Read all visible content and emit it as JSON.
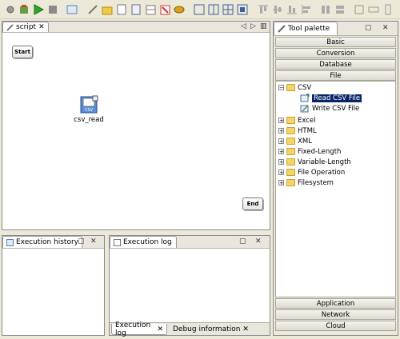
{
  "script_editor": {
    "tab_label": "script",
    "start_label": "Start",
    "end_label": "End",
    "component": {
      "label": "csv_read",
      "icon_text": "CSV"
    }
  },
  "execution_history": {
    "title": "Execution history"
  },
  "execution_log": {
    "title": "Execution log",
    "bottom_tabs": [
      {
        "label": "Execution log"
      },
      {
        "label": "Debug information"
      }
    ]
  },
  "tool_palette": {
    "title": "Tool palette",
    "categories_top": [
      "Basic",
      "Conversion",
      "Database",
      "File"
    ],
    "categories_bottom": [
      "Application",
      "Network",
      "Cloud"
    ],
    "tree": {
      "root": "CSV",
      "children": [
        "Read CSV File",
        "Write CSV File"
      ],
      "selected": "Read CSV File",
      "folders": [
        "Excel",
        "HTML",
        "XML",
        "Fixed-Length",
        "Variable-Length",
        "File Operation",
        "Filesystem"
      ]
    }
  },
  "colors": {
    "selection": "#0a246a",
    "folder": "#f4d36a",
    "background": "#ece9d8"
  }
}
